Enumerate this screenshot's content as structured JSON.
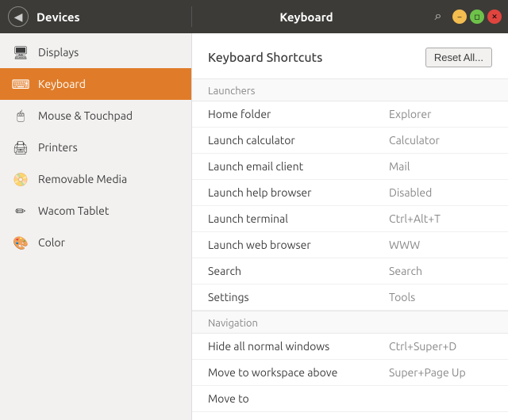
{
  "titlebar": {
    "back_icon": "◀",
    "section_title": "Devices",
    "center_title": "Keyboard",
    "search_icon": "🔍",
    "window_controls": {
      "min_label": "–",
      "max_label": "◻",
      "close_label": "✕"
    }
  },
  "sidebar": {
    "items": [
      {
        "id": "displays",
        "label": "Displays",
        "icon": "🖥"
      },
      {
        "id": "keyboard",
        "label": "Keyboard",
        "icon": "⌨",
        "active": true
      },
      {
        "id": "mouse",
        "label": "Mouse & Touchpad",
        "icon": "🖱"
      },
      {
        "id": "printers",
        "label": "Printers",
        "icon": "🖨"
      },
      {
        "id": "removable",
        "label": "Removable Media",
        "icon": "📀"
      },
      {
        "id": "wacom",
        "label": "Wacom Tablet",
        "icon": "✏"
      },
      {
        "id": "color",
        "label": "Color",
        "icon": "🎨"
      }
    ]
  },
  "content": {
    "title": "Keyboard Shortcuts",
    "reset_label": "Reset All...",
    "sections": [
      {
        "id": "launchers",
        "header": "Launchers",
        "shortcuts": [
          {
            "name": "Home folder",
            "key": "Explorer"
          },
          {
            "name": "Launch calculator",
            "key": "Calculator"
          },
          {
            "name": "Launch email client",
            "key": "Mail"
          },
          {
            "name": "Launch help browser",
            "key": "Disabled"
          },
          {
            "name": "Launch terminal",
            "key": "Ctrl+Alt+T"
          },
          {
            "name": "Launch web browser",
            "key": "WWW"
          },
          {
            "name": "Search",
            "key": "Search"
          },
          {
            "name": "Settings",
            "key": "Tools"
          }
        ]
      },
      {
        "id": "navigation",
        "header": "Navigation",
        "shortcuts": [
          {
            "name": "Hide all normal windows",
            "key": "Ctrl+Super+D"
          },
          {
            "name": "Move to workspace above",
            "key": "Super+Page Up"
          },
          {
            "name": "Move to",
            "key": ""
          }
        ]
      }
    ]
  }
}
